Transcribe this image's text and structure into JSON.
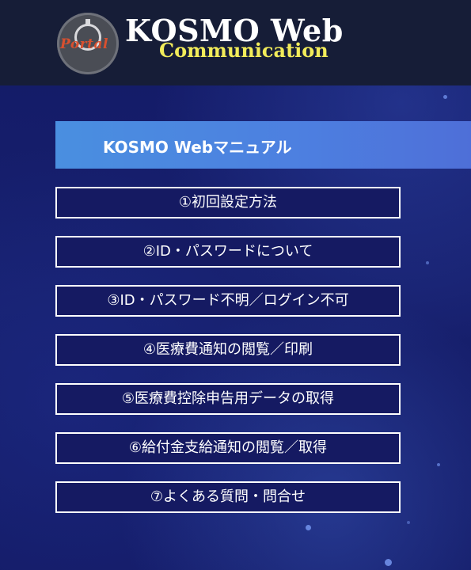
{
  "header": {
    "logo": {
      "badge_text": "Portal",
      "title": "KOSMO Web",
      "subtitle": "Communication"
    }
  },
  "banner": {
    "title": "KOSMO Webマニュアル"
  },
  "menu": {
    "items": [
      {
        "label": "①初回設定方法"
      },
      {
        "label": "②ID・パスワードについて"
      },
      {
        "label": "③ID・パスワード不明／ログイン不可"
      },
      {
        "label": "④医療費通知の閲覧／印刷"
      },
      {
        "label": "⑤医療費控除申告用データの取得"
      },
      {
        "label": "⑥給付金支給通知の閲覧／取得"
      },
      {
        "label": "⑦よくある質問・問合せ"
      }
    ]
  },
  "colors": {
    "header_bg": "#161d37",
    "page_bg": "#151b6a",
    "banner_gradient_start": "#4a8fe0",
    "banner_gradient_end": "#4e6fd8",
    "logo_subtitle": "#f2ec5a",
    "logo_badge_text": "#d8502f",
    "button_border": "#ffffff"
  }
}
